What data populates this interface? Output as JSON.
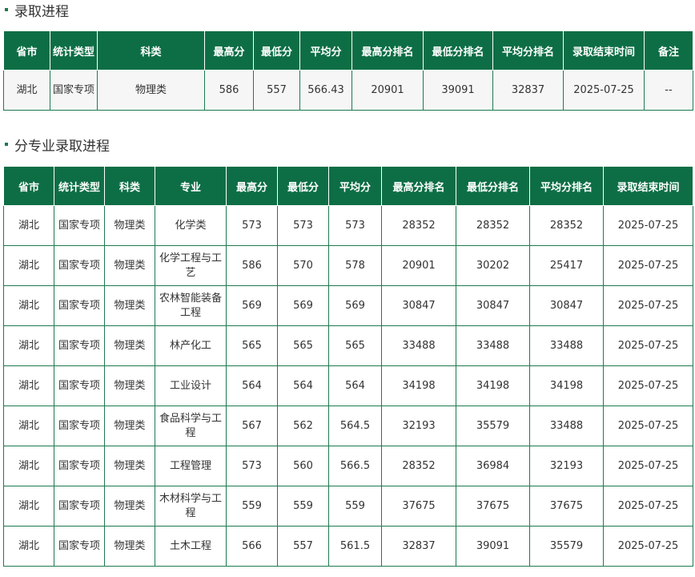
{
  "section1": {
    "title": "录取进程",
    "headers": [
      "省市",
      "统计类型",
      "科类",
      "最高分",
      "最低分",
      "平均分",
      "最高分排名",
      "最低分排名",
      "平均分排名",
      "录取结束时间",
      "备注"
    ],
    "rows": [
      [
        "湖北",
        "国家专项",
        "物理类",
        "586",
        "557",
        "566.43",
        "20901",
        "39091",
        "32837",
        "2025-07-25",
        "--"
      ]
    ]
  },
  "section2": {
    "title": "分专业录取进程",
    "headers": [
      "省市",
      "统计类型",
      "科类",
      "专业",
      "最高分",
      "最低分",
      "平均分",
      "最高分排名",
      "最低分排名",
      "平均分排名",
      "录取结束时间"
    ],
    "rows": [
      [
        "湖北",
        "国家专项",
        "物理类",
        "化学类",
        "573",
        "573",
        "573",
        "28352",
        "28352",
        "28352",
        "2025-07-25"
      ],
      [
        "湖北",
        "国家专项",
        "物理类",
        "化学工程与工艺",
        "586",
        "570",
        "578",
        "20901",
        "30202",
        "25417",
        "2025-07-25"
      ],
      [
        "湖北",
        "国家专项",
        "物理类",
        "农林智能装备工程",
        "569",
        "569",
        "569",
        "30847",
        "30847",
        "30847",
        "2025-07-25"
      ],
      [
        "湖北",
        "国家专项",
        "物理类",
        "林产化工",
        "565",
        "565",
        "565",
        "33488",
        "33488",
        "33488",
        "2025-07-25"
      ],
      [
        "湖北",
        "国家专项",
        "物理类",
        "工业设计",
        "564",
        "564",
        "564",
        "34198",
        "34198",
        "34198",
        "2025-07-25"
      ],
      [
        "湖北",
        "国家专项",
        "物理类",
        "食品科学与工程",
        "567",
        "562",
        "564.5",
        "32193",
        "35579",
        "33488",
        "2025-07-25"
      ],
      [
        "湖北",
        "国家专项",
        "物理类",
        "工程管理",
        "573",
        "560",
        "566.5",
        "28352",
        "36984",
        "32193",
        "2025-07-25"
      ],
      [
        "湖北",
        "国家专项",
        "物理类",
        "木材科学与工程",
        "559",
        "559",
        "559",
        "37675",
        "37675",
        "37675",
        "2025-07-25"
      ],
      [
        "湖北",
        "国家专项",
        "物理类",
        "土木工程",
        "566",
        "557",
        "561.5",
        "32837",
        "39091",
        "35579",
        "2025-07-25"
      ]
    ]
  }
}
